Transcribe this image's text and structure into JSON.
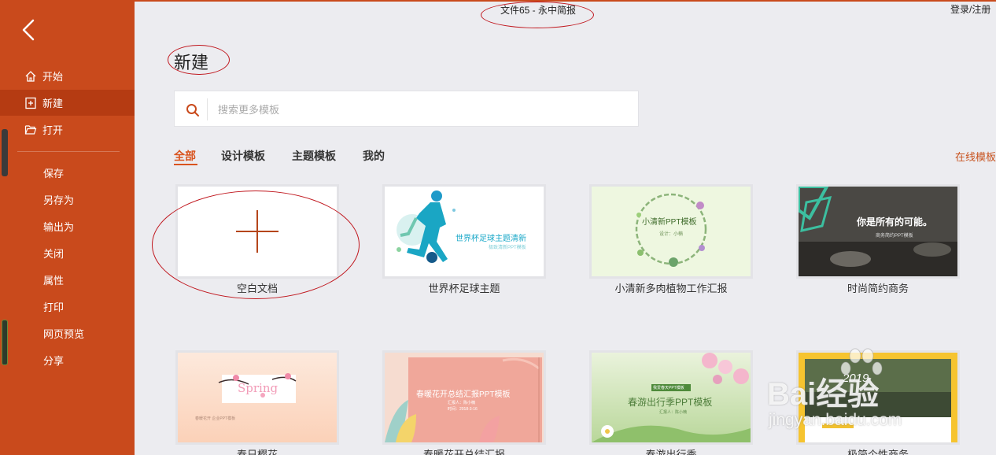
{
  "window": {
    "doc_title": "文件65 - 永中简报",
    "login_text": "登录/注册"
  },
  "sidebar": {
    "back_icon": "back-arrow-icon",
    "nav": [
      {
        "label": "开始",
        "icon": "home-icon"
      },
      {
        "label": "新建",
        "icon": "new-file-icon",
        "active": true
      },
      {
        "label": "打开",
        "icon": "folder-open-icon"
      }
    ],
    "sub": [
      {
        "label": "保存"
      },
      {
        "label": "另存为"
      },
      {
        "label": "输出为"
      },
      {
        "label": "关闭"
      },
      {
        "label": "属性"
      },
      {
        "label": "打印"
      },
      {
        "label": "网页预览"
      },
      {
        "label": "分享"
      }
    ]
  },
  "main": {
    "title": "新建",
    "search": {
      "placeholder": "搜索更多模板",
      "value": ""
    },
    "tabs": [
      {
        "label": "全部",
        "active": true
      },
      {
        "label": "设计模板"
      },
      {
        "label": "主题模板"
      },
      {
        "label": "我的"
      }
    ],
    "online_link": "在线模板",
    "templates": [
      {
        "label": "空白文档"
      },
      {
        "label": "世界杯足球主题",
        "thumb_title": "世界杯足球主题清新",
        "thumb_sub": "极致清新PPT模板"
      },
      {
        "label": "小清新多肉植物工作汇报",
        "thumb_title": "小清新PPT模板",
        "thumb_sub": "设计：小楠"
      },
      {
        "label": "时尚简约商务",
        "thumb_title": "你是所有的可能。",
        "thumb_sub": "商务简约PPT模板"
      },
      {
        "label": "春日樱花",
        "thumb_title": "Spring",
        "thumb_sub": "春暖花开 企业PPT模板"
      },
      {
        "label": "春暖花开总结汇报",
        "thumb_title": "春暖花开总结汇报PPT模板",
        "thumb_sub": "汇报人：陈小楠",
        "thumb_date": "时间：2018-3-16"
      },
      {
        "label": "春游出行季",
        "thumb_title": "春游出行季PPT模板",
        "thumb_tag": "我爱春天PPT模板",
        "thumb_sub": "汇报人：陈小楠"
      },
      {
        "label": "极简个性商务",
        "thumb_title": "2019"
      }
    ]
  },
  "watermark": {
    "brand": "Bai经验",
    "url": "jingyan.baidu.com"
  },
  "colors": {
    "accent": "#c94a1c",
    "accent_active": "#b53b12",
    "tab_active": "#d9531e",
    "annotation": "#c0171e"
  }
}
